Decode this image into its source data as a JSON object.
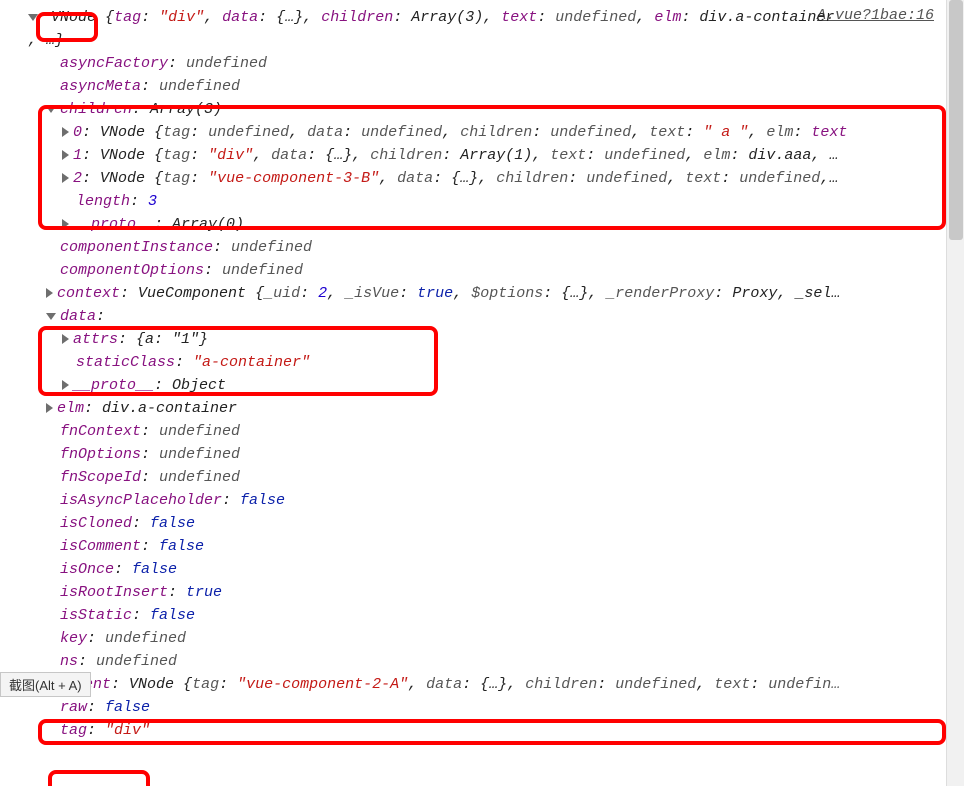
{
  "source_link": "A.vue?1bae:16",
  "tooltip": "截图(Alt + A)",
  "header": {
    "cls": "VNode",
    "tag_k": "tag",
    "tag_v": "\"div\"",
    "data_k": "data",
    "data_v": "{…}",
    "children_k": "children",
    "children_v": "Array(3)",
    "text_k": "text",
    "text_v": "undefined",
    "elm_k": "elm",
    "elm_v": "div.a-container",
    "trail": ", …}"
  },
  "props": {
    "asyncFactory_k": "asyncFactory",
    "asyncFactory_v": "undefined",
    "asyncMeta_k": "asyncMeta",
    "asyncMeta_v": "undefined",
    "children_k": "children",
    "children_v": "Array(3)",
    "child0_idx": "0",
    "child0_cls": "VNode",
    "child0_tag_k": "tag",
    "child0_tag_v": "undefined",
    "child0_data_k": "data",
    "child0_data_v": "undefined",
    "child0_children_k": "children",
    "child0_children_v": "undefined",
    "child0_text_k": "text",
    "child0_text_v": "\" a \"",
    "child0_elm_k": "elm",
    "child0_elm_v": "text",
    "child1_idx": "1",
    "child1_cls": "VNode",
    "child1_tag_k": "tag",
    "child1_tag_v": "\"div\"",
    "child1_data_k": "data",
    "child1_data_v": "{…}",
    "child1_children_k": "children",
    "child1_children_v": "Array(1)",
    "child1_text_k": "text",
    "child1_text_v": "undefined",
    "child1_elm_k": "elm",
    "child1_elm_v": "div.aaa",
    "child2_idx": "2",
    "child2_cls": "VNode",
    "child2_tag_k": "tag",
    "child2_tag_v": "\"vue-component-3-B\"",
    "child2_data_k": "data",
    "child2_data_v": "{…}",
    "child2_children_k": "children",
    "child2_children_v": "undefined",
    "child2_text_k": "text",
    "child2_text_v": "undefined",
    "length_k": "length",
    "length_v": "3",
    "proto_k": "__proto__",
    "proto_v": "Array(0)",
    "componentInstance_k": "componentInstance",
    "componentInstance_v": "undefined",
    "componentOptions_k": "componentOptions",
    "componentOptions_v": "undefined",
    "context_k": "context",
    "context_v": "VueComponent",
    "context_uid_k": "_uid",
    "context_uid_v": "2",
    "context_isVue_k": "_isVue",
    "context_isVue_v": "true",
    "context_opts_k": "$options",
    "context_opts_v": "{…}",
    "context_rp_k": "_renderProxy",
    "context_rp_v": "Proxy",
    "context_trail": ", _sel…",
    "data_k": "data",
    "attrs_k": "attrs",
    "attrs_v": "{a: \"1\"}",
    "staticClass_k": "staticClass",
    "staticClass_v": "\"a-container\"",
    "proto2_k": "__proto__",
    "proto2_v": "Object",
    "elm_k": "elm",
    "elm_v": "div.a-container",
    "fnContext_k": "fnContext",
    "fnContext_v": "undefined",
    "fnOptions_k": "fnOptions",
    "fnOptions_v": "undefined",
    "fnScopeId_k": "fnScopeId",
    "fnScopeId_v": "undefined",
    "isAsyncPlaceholder_k": "isAsyncPlaceholder",
    "isAsyncPlaceholder_v": "false",
    "isCloned_k": "isCloned",
    "isCloned_v": "false",
    "isComment_k": "isComment",
    "isComment_v": "false",
    "isOnce_k": "isOnce",
    "isOnce_v": "false",
    "isRootInsert_k": "isRootInsert",
    "isRootInsert_v": "true",
    "isStatic_k": "isStatic",
    "isStatic_v": "false",
    "key_k": "key",
    "key_v": "undefined",
    "ns_k": "ns",
    "ns_v": "undefined",
    "parent_k": "parent",
    "parent_cls": "VNode",
    "parent_tag_k": "tag",
    "parent_tag_v": "\"vue-component-2-A\"",
    "parent_data_k": "data",
    "parent_data_v": "{…}",
    "parent_children_k": "children",
    "parent_children_v": "undefined",
    "parent_text_k": "text",
    "parent_text_v": "undefin…",
    "raw_k": "raw",
    "raw_v": "false",
    "tag_k": "tag",
    "tag_v": "\"div\""
  }
}
